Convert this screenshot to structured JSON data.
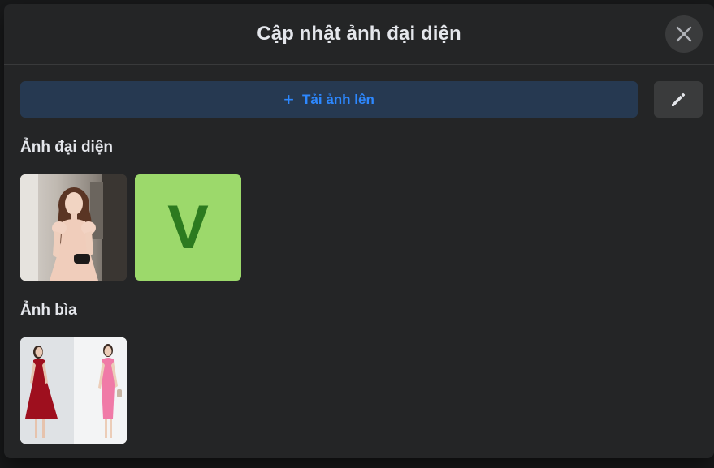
{
  "dialog": {
    "title": "Cập nhật ảnh đại diện",
    "close_icon": "close-icon"
  },
  "toolbar": {
    "upload_label": "Tải ảnh lên",
    "upload_icon": "plus-icon",
    "edit_icon": "pencil-icon"
  },
  "profile_section": {
    "title": "Ảnh đại diện",
    "items": [
      {
        "type": "photo",
        "description": "woman-in-pink-dress"
      },
      {
        "type": "letter",
        "letter": "V",
        "bg_color": "#9cd96b",
        "fg_color": "#2c7a1f"
      }
    ]
  },
  "cover_section": {
    "title": "Ảnh bìa",
    "items": [
      {
        "type": "photo",
        "description": "two-women-in-red-and-pink-dresses"
      }
    ]
  },
  "colors": {
    "background": "#242526",
    "text": "#e4e6eb",
    "accent": "#2d88ff",
    "upload_bg": "#263951",
    "button_bg": "#3a3b3c"
  }
}
